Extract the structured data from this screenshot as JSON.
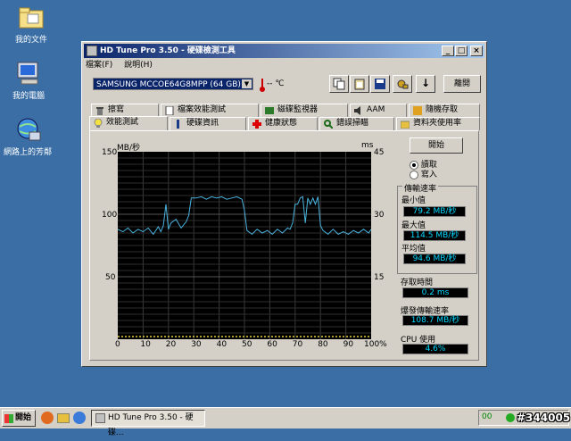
{
  "desktop": {
    "icons": [
      {
        "label": "我的文件"
      },
      {
        "label": "我的電腦"
      },
      {
        "label": "網路上的芳鄰"
      }
    ]
  },
  "window": {
    "title": "HD Tune Pro 3.50 - 硬碟檢測工具",
    "menu": [
      "檔案(F)",
      "說明(H)"
    ],
    "drive_select": "SAMSUNG MCCOE64G8MPP (64 GB)",
    "temperature": "-- ℃",
    "exit_button": "離開",
    "tabs_row1": [
      {
        "label": "擦寫",
        "icon": "trash-icon"
      },
      {
        "label": "檔案效能測試",
        "icon": "file-icon"
      },
      {
        "label": "磁碟監視器",
        "icon": "monitor-icon"
      },
      {
        "label": "AAM",
        "icon": "speaker-icon"
      },
      {
        "label": "隨機存取",
        "icon": "random-icon"
      }
    ],
    "tabs_row2": [
      {
        "label": "效能測試",
        "icon": "bulb-icon"
      },
      {
        "label": "硬碟資訊",
        "icon": "info-icon"
      },
      {
        "label": "健康狀態",
        "icon": "health-icon"
      },
      {
        "label": "錯誤掃瞄",
        "icon": "scan-icon"
      },
      {
        "label": "資料夾使用率",
        "icon": "folder-icon"
      }
    ]
  },
  "controls": {
    "start_button": "開始",
    "read_label": "讀取",
    "write_label": "寫入",
    "mode_selected": "read"
  },
  "stats": {
    "transfer_title": "傳輸速率",
    "min_label": "最小值",
    "min_value": "79.2 MB/秒",
    "max_label": "最大值",
    "max_value": "114.5 MB/秒",
    "avg_label": "平均值",
    "avg_value": "94.6 MB/秒",
    "access_label": "存取時間",
    "access_value": "0.2 ms",
    "burst_label": "爆發傳輸速率",
    "burst_value": "108.7 MB/秒",
    "cpu_label": "CPU 使用",
    "cpu_value": "4.6%"
  },
  "chart_data": {
    "type": "line",
    "y_left_unit": "MB/秒",
    "y_right_unit": "ms",
    "y_left_ticks": [
      "150",
      "100",
      "50"
    ],
    "y_right_ticks": [
      "45",
      "30",
      "15"
    ],
    "x_ticks": [
      "0",
      "10",
      "20",
      "30",
      "40",
      "50",
      "60",
      "70",
      "80",
      "90",
      "100%"
    ],
    "ylim": [
      0,
      150
    ],
    "xlim": [
      0,
      100
    ],
    "series": [
      {
        "values": [
          [
            0,
            88
          ],
          [
            2,
            86
          ],
          [
            4,
            89
          ],
          [
            6,
            85
          ],
          [
            8,
            88
          ],
          [
            10,
            86
          ],
          [
            12,
            89
          ],
          [
            14,
            84
          ],
          [
            16,
            90
          ],
          [
            17,
            86
          ],
          [
            18,
            91
          ],
          [
            19,
            108
          ],
          [
            20,
            88
          ],
          [
            21,
            93
          ],
          [
            23,
            96
          ],
          [
            25,
            89
          ],
          [
            27,
            94
          ],
          [
            28,
            99
          ],
          [
            29,
            113
          ],
          [
            31,
            113
          ],
          [
            33,
            114
          ],
          [
            35,
            112
          ],
          [
            37,
            114
          ],
          [
            39,
            113
          ],
          [
            41,
            114
          ],
          [
            43,
            112
          ],
          [
            45,
            113
          ],
          [
            47,
            114
          ],
          [
            49,
            112
          ],
          [
            50,
            103
          ],
          [
            51,
            87
          ],
          [
            53,
            84
          ],
          [
            55,
            88
          ],
          [
            57,
            85
          ],
          [
            59,
            87
          ],
          [
            61,
            84
          ],
          [
            63,
            88
          ],
          [
            65,
            85
          ],
          [
            67,
            89
          ],
          [
            68,
            88
          ],
          [
            69,
            93
          ],
          [
            70,
            108
          ],
          [
            71,
            108
          ],
          [
            72,
            113
          ],
          [
            73,
            114
          ],
          [
            74,
            93
          ],
          [
            75,
            113
          ],
          [
            76,
            108
          ],
          [
            77,
            113
          ],
          [
            78,
            108
          ],
          [
            79,
            114
          ],
          [
            80,
            91
          ],
          [
            81,
            87
          ],
          [
            83,
            84
          ],
          [
            85,
            88
          ],
          [
            87,
            84
          ],
          [
            89,
            86
          ],
          [
            91,
            84
          ],
          [
            93,
            87
          ],
          [
            95,
            85
          ],
          [
            97,
            88
          ],
          [
            99,
            85
          ],
          [
            100,
            88
          ]
        ]
      }
    ]
  },
  "taskbar": {
    "start_label": "開始",
    "task_label": "HD Tune Pro 3.50 - 硬碟...",
    "tray_temp": "00",
    "watermark": "#344005"
  }
}
